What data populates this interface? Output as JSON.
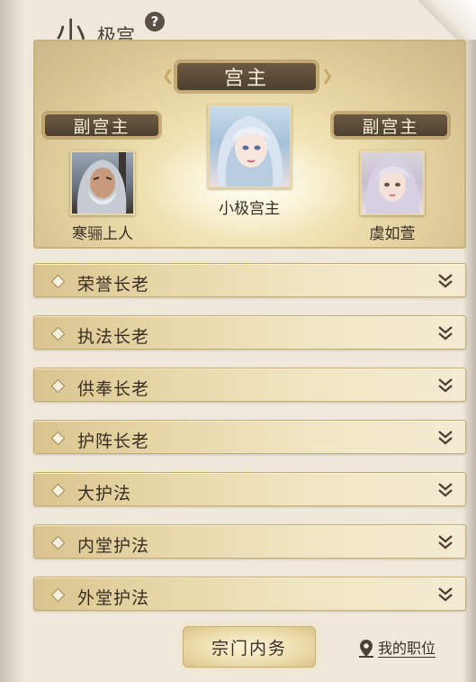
{
  "header": {
    "title_big": "小",
    "title_small": "极宫",
    "help_icon": "question-circle-icon"
  },
  "hall": {
    "main": {
      "rank": "宫主",
      "member_name": "小极宫主"
    },
    "left": {
      "rank": "副宫主",
      "member_name": "寒骊上人"
    },
    "right": {
      "rank": "副宫主",
      "member_name": "虞如萱"
    }
  },
  "ranks": [
    {
      "label": "荣誉长老",
      "expanded": false
    },
    {
      "label": "执法长老",
      "expanded": false
    },
    {
      "label": "供奉长老",
      "expanded": false
    },
    {
      "label": "护阵长老",
      "expanded": false
    },
    {
      "label": "大护法",
      "expanded": false
    },
    {
      "label": "内堂护法",
      "expanded": false
    },
    {
      "label": "外堂护法",
      "expanded": false
    }
  ],
  "footer": {
    "sect_affairs_button": "宗门内务",
    "my_position_link": "我的职位",
    "location_icon": "location-pin-icon"
  },
  "colors": {
    "banner_bg": "#5a4a36",
    "banner_border": "#c7a86a",
    "row_gold": "#e7d7a8",
    "text_dark": "#3a2e24"
  }
}
